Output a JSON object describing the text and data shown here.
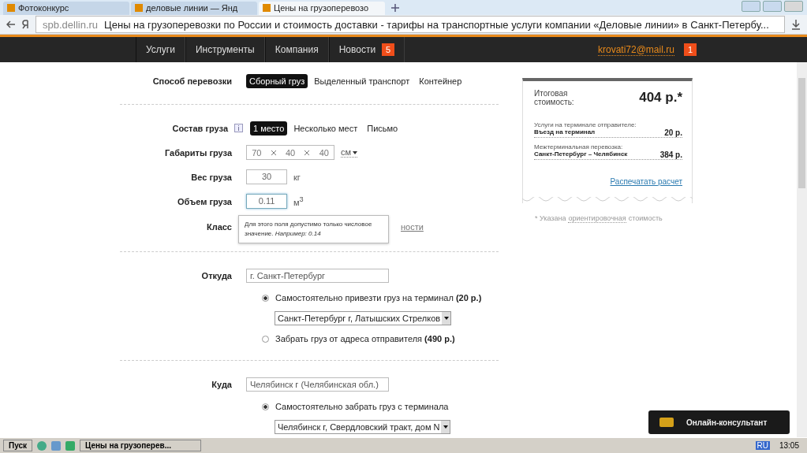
{
  "browser": {
    "tabs": [
      {
        "title": "Фотоконкурс",
        "selected": false
      },
      {
        "title": "деловые линии — Янд",
        "selected": false
      },
      {
        "title": "Цены на грузоперевозо",
        "selected": true
      }
    ],
    "url_host": "spb.dellin.ru",
    "url_title": "Цены на грузоперевозки по России и стоимость доставки - тарифы на транспортные услуги компании «Деловые линии» в Санкт-Петербу..."
  },
  "nav": {
    "items": [
      {
        "label": "Услуги"
      },
      {
        "label": "Инструменты"
      },
      {
        "label": "Компания"
      },
      {
        "label": "Новости",
        "badge": "5"
      }
    ],
    "user": "krovati72@mail.ru",
    "user_badge": "1"
  },
  "form": {
    "transport": {
      "label": "Способ перевозки",
      "options": [
        {
          "label": "Сборный груз",
          "selected": true
        },
        {
          "label": "Выделенный транспорт",
          "selected": false
        },
        {
          "label": "Контейнер",
          "selected": false
        }
      ]
    },
    "composition": {
      "label": "Состав груза",
      "options": [
        {
          "label": "1 место",
          "selected": true
        },
        {
          "label": "Несколько мест",
          "selected": false
        },
        {
          "label": "Письмо",
          "selected": false
        }
      ]
    },
    "dimensions": {
      "label": "Габариты груза",
      "values": [
        "70",
        "40",
        "40"
      ],
      "unit": "см"
    },
    "weight": {
      "label": "Вес груза",
      "value": "30",
      "unit": "кг"
    },
    "volume": {
      "label": "Объем груза",
      "value": "0.11",
      "unit": "м$^{3}$",
      "focused": true
    },
    "class_label": "Класс",
    "class_link": "ности",
    "tooltip": "Для этого поля допустимо только числовое значение. *Например: 0.14*",
    "from": {
      "label": "Откуда",
      "value": "г. Санкт-Петербург",
      "options": [
        {
          "label": "Самостоятельно привезти груз на терминал **(20 р.)**",
          "selected": true,
          "terminal": "Санкт-Петербург г, Латышских Стрелков"
        },
        {
          "label": "Забрать груз от адреса отправителя **(490 р.)**",
          "selected": false
        }
      ]
    },
    "to": {
      "label": "Куда",
      "value": "Челябинск г (Челябинская обл.)",
      "options": [
        {
          "label": "Самостоятельно забрать груз с терминала",
          "selected": true,
          "terminal": "Челябинск г, Свердловский тракт, дом N"
        }
      ]
    }
  },
  "summary": {
    "total_label": "Итоговая стоимость:",
    "total": "404 р.*",
    "items": [
      {
        "group": "Услуги на терминале отправителе:",
        "name": "Въезд на терминал",
        "price": "20 р."
      },
      {
        "group": "Межтерминальная перевозка:",
        "name": "Санкт-Петербург – Челябинск",
        "price": "384 р."
      }
    ],
    "print_link": "Распечатать расчет",
    "note_prefix": "* Указана",
    "note_link": "ориентировочная",
    "note_suffix": "стоимость"
  },
  "chat": {
    "label": "Онлайн-консультант"
  },
  "taskbar": {
    "start": "Пуск",
    "window": "Цены на грузоперев...",
    "lang": "RU",
    "clock": "13:05"
  }
}
